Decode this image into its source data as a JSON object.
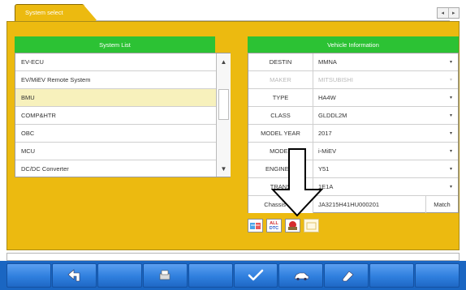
{
  "tabs": {
    "active_label": "System select"
  },
  "nav": {
    "prev_icon": "◂",
    "next_icon": "▸"
  },
  "system_list": {
    "header": "System List",
    "items": [
      {
        "label": "EV-ECU",
        "selected": false
      },
      {
        "label": "EV/MiEV Remote System",
        "selected": false
      },
      {
        "label": "BMU",
        "selected": true
      },
      {
        "label": "COMP&HTR",
        "selected": false
      },
      {
        "label": "OBC",
        "selected": false
      },
      {
        "label": "MCU",
        "selected": false
      },
      {
        "label": "DC/DC Converter",
        "selected": false
      }
    ],
    "scroll_up_icon": "▲",
    "scroll_down_icon": "▼"
  },
  "vehicle_info": {
    "header": "Vehicle Information",
    "rows": [
      {
        "label": "DESTIN",
        "value": "MMNA",
        "disabled": false
      },
      {
        "label": "MAKER",
        "value": "MITSUBISHI",
        "disabled": true
      },
      {
        "label": "TYPE",
        "value": "HA4W",
        "disabled": false
      },
      {
        "label": "CLASS",
        "value": "GLDDL2M",
        "disabled": false
      },
      {
        "label": "MODEL YEAR",
        "value": "2017",
        "disabled": false
      },
      {
        "label": "MODEL",
        "value": "i-MiEV",
        "disabled": false
      },
      {
        "label": "ENGINE/M",
        "value": "Y51",
        "disabled": false
      },
      {
        "label": "TRANS",
        "value": "1E1A",
        "disabled": false
      }
    ],
    "chassis": {
      "label": "Chassis No.",
      "value": "JA3215H41HU000201",
      "match_label": "Match"
    },
    "caret": "▾"
  },
  "function_icons": {
    "all_dtc_line1": "ALL",
    "all_dtc_line2": "DTC"
  },
  "colors": {
    "panel": "#ecba10",
    "header_green": "#2cc234",
    "toolbar_blue": "#1a66c2"
  }
}
